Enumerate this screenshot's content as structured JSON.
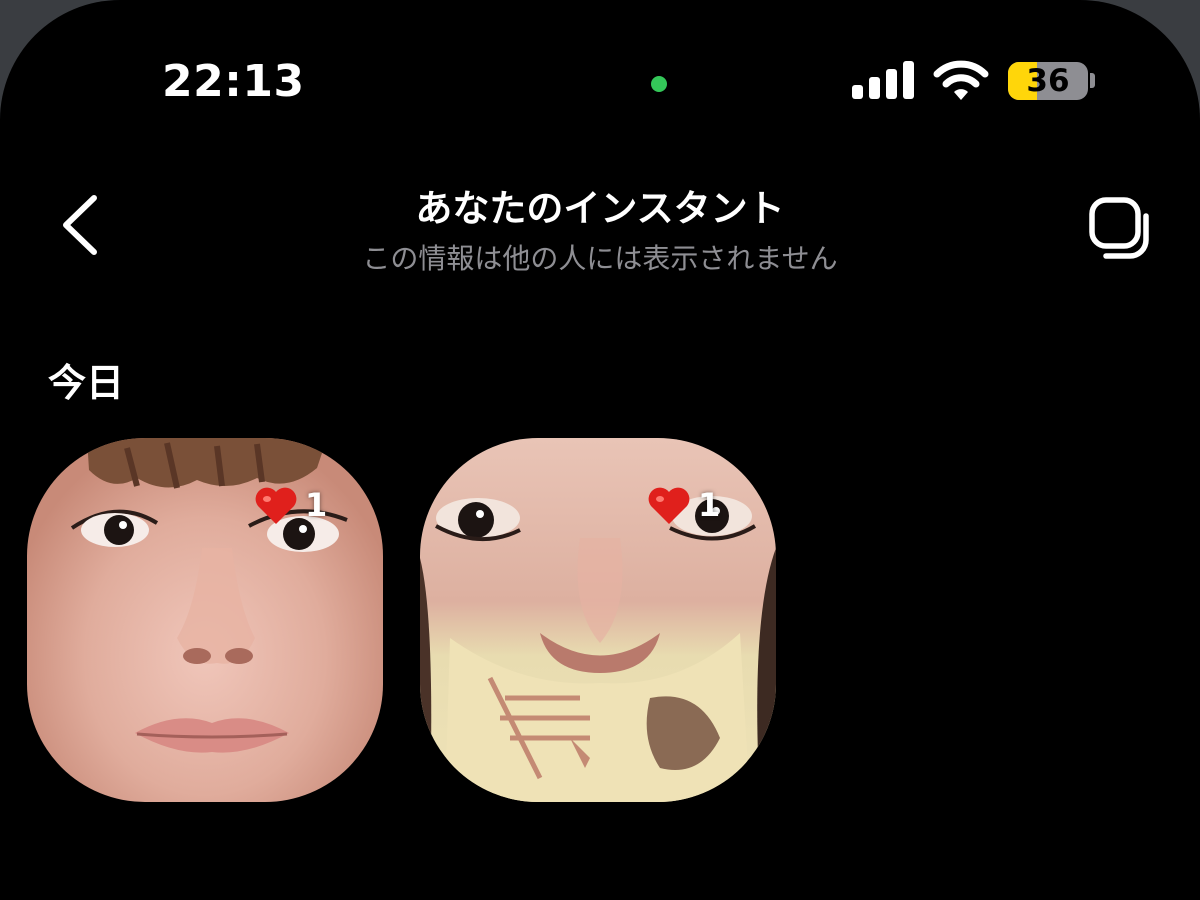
{
  "status_bar": {
    "time": "22:13",
    "battery": "36",
    "battery_level": 0.36,
    "icons": [
      "camera-in-use-indicator",
      "signal-icon",
      "wifi-icon",
      "battery-icon"
    ],
    "colors": {
      "indicator": "#34c759",
      "battery_fill": "#ffd60a"
    }
  },
  "nav": {
    "title": "あなたのインスタント",
    "subtitle": "この情報は他の人には表示されません",
    "back_icon": "chevron-left-icon",
    "action_icon": "stacked-squares-icon"
  },
  "section": {
    "label": "今日"
  },
  "instants": [
    {
      "reaction_emoji": "❤️",
      "reaction_count": "1",
      "photo": "selfie-front-face"
    },
    {
      "reaction_emoji": "❤️",
      "reaction_count": "1",
      "photo": "selfie-low-angle-face"
    }
  ]
}
